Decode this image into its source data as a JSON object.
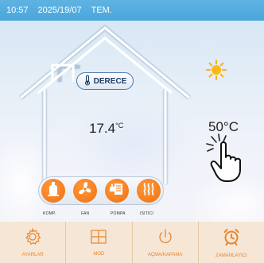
{
  "status_bar": {
    "time": "10:57",
    "date": "2025/19/07",
    "mode": "TEM."
  },
  "main": {
    "badge_label": "DERECE",
    "indoor_temp_value": "17.4",
    "indoor_temp_unit": "°C",
    "setpoint_temp": "50°C"
  },
  "components": [
    {
      "label": "KOMP.",
      "icon": "compressor-icon"
    },
    {
      "label": "FAN",
      "icon": "fan-icon"
    },
    {
      "label": "POMPA",
      "icon": "pump-icon"
    },
    {
      "label": "ISITICI",
      "icon": "heater-icon"
    }
  ],
  "nav": {
    "items": [
      {
        "label": "AYARLAR",
        "icon": "gear-icon"
      },
      {
        "label": "MOD",
        "icon": "grid-icon"
      },
      {
        "label": "AÇMA/KAPAMA",
        "icon": "power-icon"
      },
      {
        "label": "ZAMANLAYICI",
        "icon": "alarm-clock-icon"
      }
    ]
  },
  "colors": {
    "accent": "#f07a1a",
    "status_bar": "#4aa6dc",
    "house_outline": "#ffffff",
    "nav_bg": "#f5e6d6"
  }
}
